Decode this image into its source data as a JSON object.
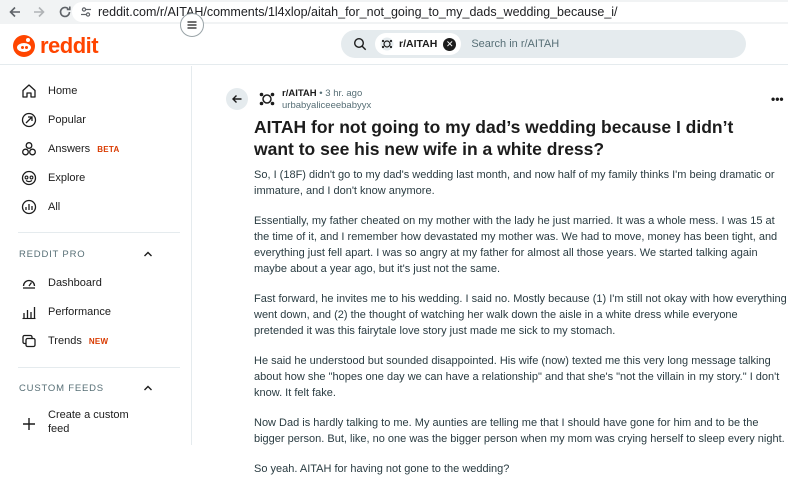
{
  "browser": {
    "url": "reddit.com/r/AITAH/comments/1l4xlop/aitah_for_not_going_to_my_dads_wedding_because_i/"
  },
  "header": {
    "logo_text": "reddit",
    "search": {
      "chip_label": "r/AITAH",
      "placeholder": "Search in r/AITAH"
    }
  },
  "sidebar": {
    "items": [
      {
        "label": "Home",
        "icon": "home-icon"
      },
      {
        "label": "Popular",
        "icon": "popular-icon"
      },
      {
        "label": "Answers",
        "icon": "answers-icon",
        "badge": "BETA"
      },
      {
        "label": "Explore",
        "icon": "explore-icon"
      },
      {
        "label": "All",
        "icon": "all-icon"
      }
    ],
    "pro_section": {
      "title": "REDDIT PRO",
      "items": [
        {
          "label": "Dashboard",
          "icon": "dashboard-icon"
        },
        {
          "label": "Performance",
          "icon": "performance-icon"
        },
        {
          "label": "Trends",
          "icon": "trends-icon",
          "badge": "NEW"
        }
      ]
    },
    "custom_feeds": {
      "title": "CUSTOM FEEDS",
      "create_label": "Create a custom feed"
    }
  },
  "post": {
    "subreddit": "r/AITAH",
    "time": "3 hr. ago",
    "separator": "•",
    "author": "urbabyaliceeebabyyx",
    "more": "•••",
    "title": "AITAH for not going to my dad’s wedding because I didn’t want to see his new wife in a white dress?",
    "paragraphs": [
      "So, I (18F) didn't go to my dad's wedding last month, and now half of my family thinks I'm being dramatic or immature, and I don't know anymore.",
      "Essentially, my father cheated on my mother with the lady he just married. It was a whole mess. I was 15 at the time of it, and I remember how devastated my mother was. We had to move, money has been tight, and everything just fell apart. I was so angry at my father for almost all those years. We started talking again maybe about a year ago, but it's just not the same.",
      "Fast forward, he invites me to his wedding. I said no. Mostly because (1) I'm still not okay with how everything went down, and (2) the thought of watching her walk down the aisle in a white dress while everyone pretended it was this fairytale love story just made me sick to my stomach.",
      "He said he understood but sounded disappointed. His wife (now) texted me this very long message talking about how she \"hopes one day we can have a relationship\" and that she's \"not the villain in my story.\" I don't know. It felt fake.",
      "Now Dad is hardly talking to me. My aunties are telling me that I should have gone for him and to be the bigger person. But, like, no one was the bigger person when my mom was crying herself to sleep every night.",
      "So yeah. AITAH for having not gone to the wedding?"
    ]
  },
  "colors": {
    "brand": "#ff4500",
    "badge": "#d93a00",
    "search_bg": "#e5ebee",
    "muted_text": "#576f76"
  }
}
